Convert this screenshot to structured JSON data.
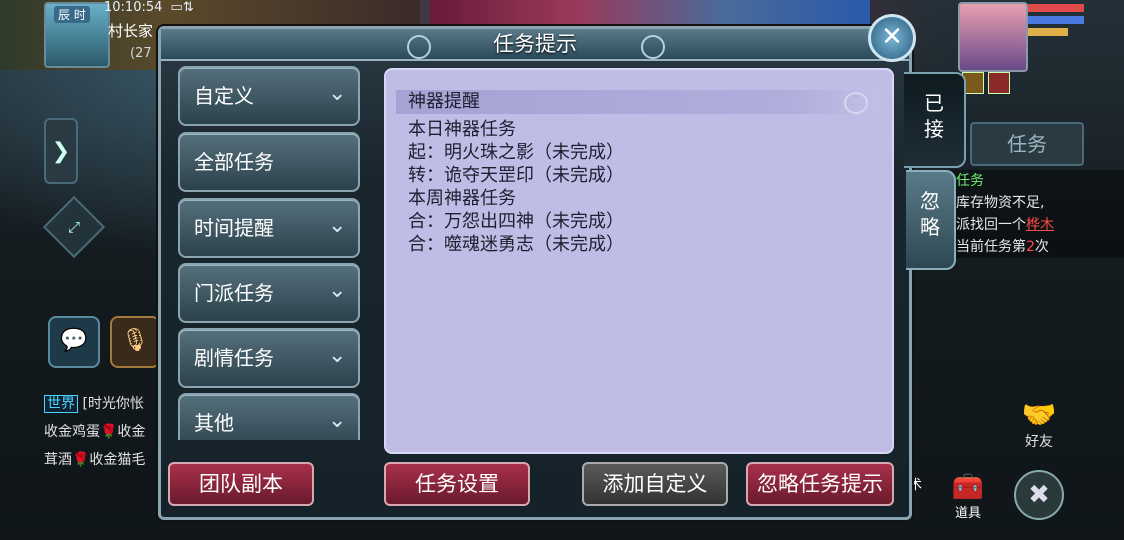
{
  "status_bar": {
    "clock": "10:10:54",
    "period": "辰 时"
  },
  "player": {
    "name": "村长家",
    "level_partial": "(27"
  },
  "chat": {
    "lines": [
      {
        "channel": "世界",
        "text": "[时光你怅"
      },
      {
        "text": "收金鸡蛋🌹收金"
      },
      {
        "text": "茸酒🌹收金猫毛"
      }
    ]
  },
  "right_panel": {
    "task_tab": "任务",
    "task_text": {
      "line1": "任务",
      "line2": "库存物资不足,",
      "line3a": "派找回一个",
      "line3b": "桦木",
      "line4a": "当前任务第",
      "line4b": "2",
      "line4c": "次"
    },
    "friends": "好友",
    "items": "道具",
    "spells": "法术"
  },
  "dialog": {
    "title": "任务提示",
    "menu": [
      {
        "label": "自定义",
        "chevron": true
      },
      {
        "label": "全部任务",
        "chevron": false
      },
      {
        "label": "时间提醒",
        "chevron": true
      },
      {
        "label": "门派任务",
        "chevron": true
      },
      {
        "label": "剧情任务",
        "chevron": true
      },
      {
        "label": "其他",
        "chevron": true
      }
    ],
    "content": {
      "section": "神器提醒",
      "lines": [
        "本日神器任务",
        "起：明火珠之影（未完成）",
        "转：诡夺天罡印（未完成）",
        "本周神器任务",
        "合：万怨出四神（未完成）",
        "合：噬魂迷勇志（未完成）"
      ]
    },
    "buttons": {
      "team_dungeon": "团队副本",
      "task_settings": "任务设置",
      "add_custom": "添加自定义",
      "ignore_tips": "忽略任务提示"
    },
    "side_tabs": {
      "accepted": "已接",
      "ignored": "忽略"
    }
  },
  "colors": {
    "accent_red": "#a8304a",
    "content_bg": "#bfbce6",
    "panel_border": "#8aa4b2"
  }
}
